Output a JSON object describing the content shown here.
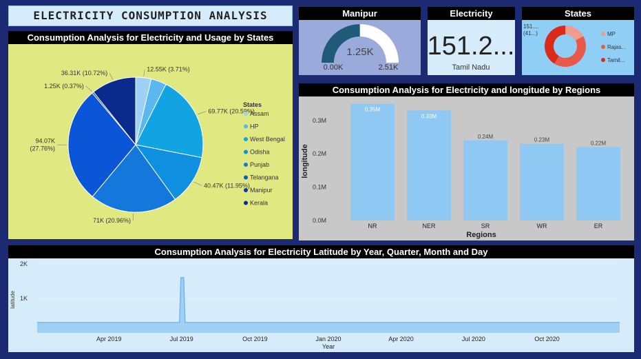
{
  "title": "ELECTRICITY CONSUMPTION ANALYSIS",
  "pie_chart": {
    "header": "Consumption Analysis for Electricity and Usage by States",
    "legend_title": "States"
  },
  "gauge": {
    "header": "Manipur",
    "value": 1.25,
    "value_label": "1.25K",
    "min_label": "0.00K",
    "max_label": "2.51K",
    "min": 0,
    "max": 2.51
  },
  "card": {
    "header": "Electricity",
    "value": "151.2...",
    "subtitle": "Tamil Nadu"
  },
  "donut": {
    "header": "States",
    "label_top": "151....",
    "label_pct": "(41...)",
    "legend": [
      "MP",
      "Rajas...",
      "Tamil..."
    ],
    "colors": [
      "#f19b8c",
      "#e8594a",
      "#d92a1c"
    ]
  },
  "bar_chart": {
    "header": "Consumption Analysis for Electricity and longitude by Regions"
  },
  "line_chart": {
    "header": "Consumption Analysis for Electricity Latitude by Year, Quarter, Month and Day"
  },
  "chart_data": [
    {
      "type": "pie",
      "title": "Consumption Analysis for Electricity and Usage by States",
      "legend_title": "States",
      "legend_position": "right",
      "slices": [
        {
          "name": "Assam",
          "value": 12.55,
          "label": "12.55K (3.71%)",
          "color": "#9fd0f5"
        },
        {
          "name": "HP",
          "value": 12.55,
          "label": "",
          "color": "#5bb8ee"
        },
        {
          "name": "West Bengal",
          "value": 69.77,
          "label": "69.77K (20.59%)",
          "color": "#12a3e3"
        },
        {
          "name": "Odisha",
          "value": 40.47,
          "label": "40.47K (11.95%)",
          "color": "#0f8fe0"
        },
        {
          "name": "Punjab",
          "value": 71,
          "label": "71K (20.96%)",
          "color": "#1477dc"
        },
        {
          "name": "Telangana",
          "value": 94.07,
          "label": "94.07K\n(27.76%)",
          "color": "#0b56d6"
        },
        {
          "name": "Manipur",
          "value": 1.25,
          "label": "1.25K (0.37%)",
          "color": "#0a3aa8"
        },
        {
          "name": "Kerala",
          "value": 36.31,
          "label": "36.31K (10.72%)",
          "color": "#0a2a8c"
        }
      ]
    },
    {
      "type": "donut",
      "title": "States",
      "slices": [
        {
          "name": "MP",
          "value": 17
        },
        {
          "name": "Rajas...",
          "value": 42
        },
        {
          "name": "Tamil...",
          "value": 41
        }
      ]
    },
    {
      "type": "bar",
      "title": "Consumption Analysis for Electricity and longitude by Regions",
      "categories": [
        "NR",
        "NER",
        "SR",
        "WR",
        "ER"
      ],
      "values": [
        0.35,
        0.33,
        0.24,
        0.23,
        0.22
      ],
      "value_labels": [
        "0.35M",
        "0.33M",
        "0.24M",
        "0.23M",
        "0.22M"
      ],
      "xlabel": "Regions",
      "ylabel": "longitude",
      "ylim": [
        0,
        0.35
      ],
      "yticks": [
        0,
        0.1,
        0.2,
        0.3
      ],
      "ytick_labels": [
        "0.0M",
        "0.1M",
        "0.2M",
        "0.3M"
      ],
      "bar_color": "#8ec8f3"
    },
    {
      "type": "area",
      "title": "Consumption Analysis for Electricity Latitude by Year, Quarter, Month and Day",
      "xlabel": "Year",
      "ylabel": "latitude",
      "ylim": [
        0,
        2
      ],
      "yticks": [
        1,
        2
      ],
      "ytick_labels": [
        "1K",
        "2K"
      ],
      "xtick_labels": [
        "Apr 2019",
        "Jul 2019",
        "Oct 2019",
        "Jan 2020",
        "Apr 2020",
        "Jul 2020",
        "Oct 2020"
      ],
      "x_range": [
        "2019-01-01",
        "2020-12-31"
      ],
      "baseline": 0.3,
      "spike": {
        "x": "2019-07-01",
        "value": 1.6
      },
      "color": "#8ec8f3"
    }
  ]
}
